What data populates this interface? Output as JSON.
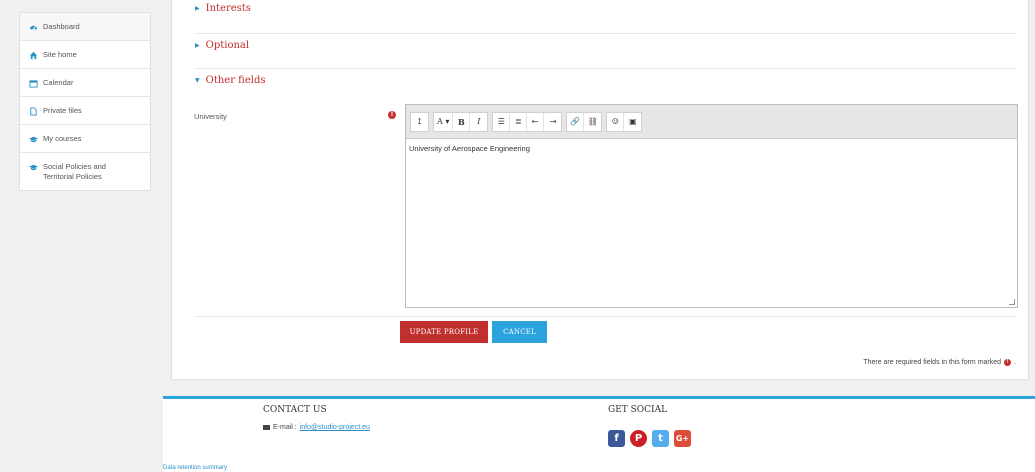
{
  "sidebar": {
    "items": [
      {
        "label": "Dashboard",
        "icon": "dashboard-icon"
      },
      {
        "label": "Site home",
        "icon": "home-icon"
      },
      {
        "label": "Calendar",
        "icon": "calendar-icon"
      },
      {
        "label": "Private files",
        "icon": "file-icon"
      },
      {
        "label": "My courses",
        "icon": "graduation-cap-icon"
      },
      {
        "label": "Social Policies and Territorial Policies",
        "icon": "graduation-cap-icon"
      }
    ]
  },
  "form": {
    "sections": [
      {
        "label": "Interests",
        "state": "collapsed"
      },
      {
        "label": "Optional",
        "state": "collapsed"
      },
      {
        "label": "Other fields",
        "state": "expanded"
      }
    ],
    "field": {
      "label": "University",
      "value": "University of Aerospace Engineering",
      "required": true
    },
    "toolbar": {
      "groups": [
        [
          "↥"
        ],
        [
          "A ▾",
          "B",
          "I"
        ],
        [
          "☰",
          "≣",
          "⇤",
          "⇥"
        ],
        [
          "🔗",
          "⛓"
        ],
        [
          "☺",
          "▣"
        ]
      ]
    },
    "buttons": {
      "update": "UPDATE PROFILE",
      "cancel": "CANCEL"
    },
    "required_note": "There are required fields in this form marked"
  },
  "footer": {
    "contact_heading": "CONTACT US",
    "email_label": "E-mail :",
    "email": "info@studio-project.eu",
    "social_heading": "GET SOCIAL",
    "social": [
      "f",
      "P",
      "t",
      "G+"
    ],
    "bottom_link": "Data retention summary"
  },
  "colors": {
    "accent_red": "#c0302e",
    "accent_blue": "#2ba3dd",
    "facebook": "#3b5998",
    "pinterest": "#cb2027",
    "twitter": "#55acee",
    "google": "#dd4b39"
  }
}
